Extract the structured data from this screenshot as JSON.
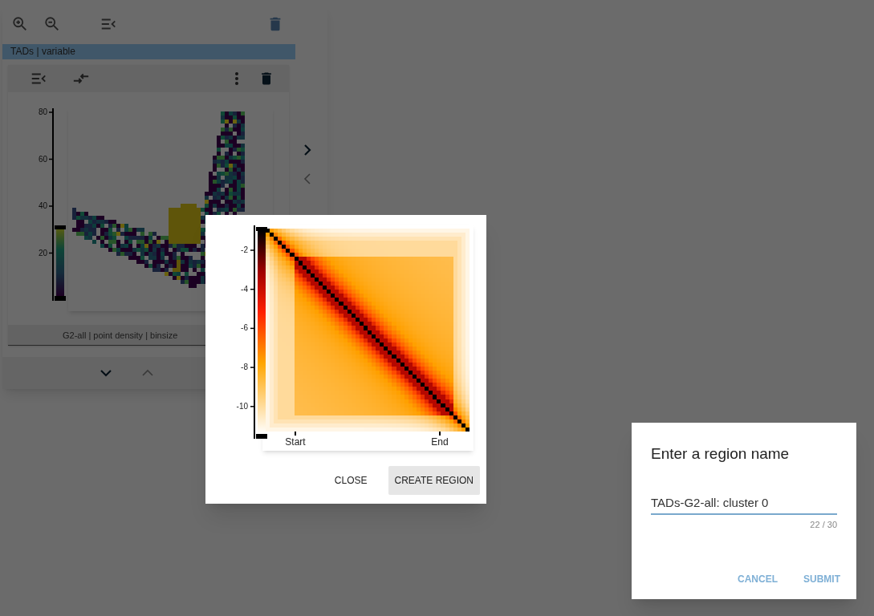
{
  "panel": {
    "layer_title": "TADs | variable",
    "colorbar_ticks": [
      "80",
      "60",
      "40",
      "20"
    ],
    "plot_caption": "G2-all | point density | binsize"
  },
  "contact_dialog": {
    "colorbar_ticks": [
      "-2",
      "-4",
      "-6",
      "-8",
      "-10"
    ],
    "x_labels": [
      "Start",
      "End"
    ],
    "buttons": [
      {
        "label": "CLOSE",
        "highlighted": false
      },
      {
        "label": "CREATE REGION",
        "highlighted": true
      }
    ]
  },
  "name_dialog": {
    "title": "Enter a region name",
    "value": "TADs-G2-all: cluster 0",
    "counter": "22 / 30",
    "buttons": [
      {
        "label": "CANCEL",
        "highlighted": false
      },
      {
        "label": "SUBMIT",
        "highlighted": false
      }
    ]
  }
}
